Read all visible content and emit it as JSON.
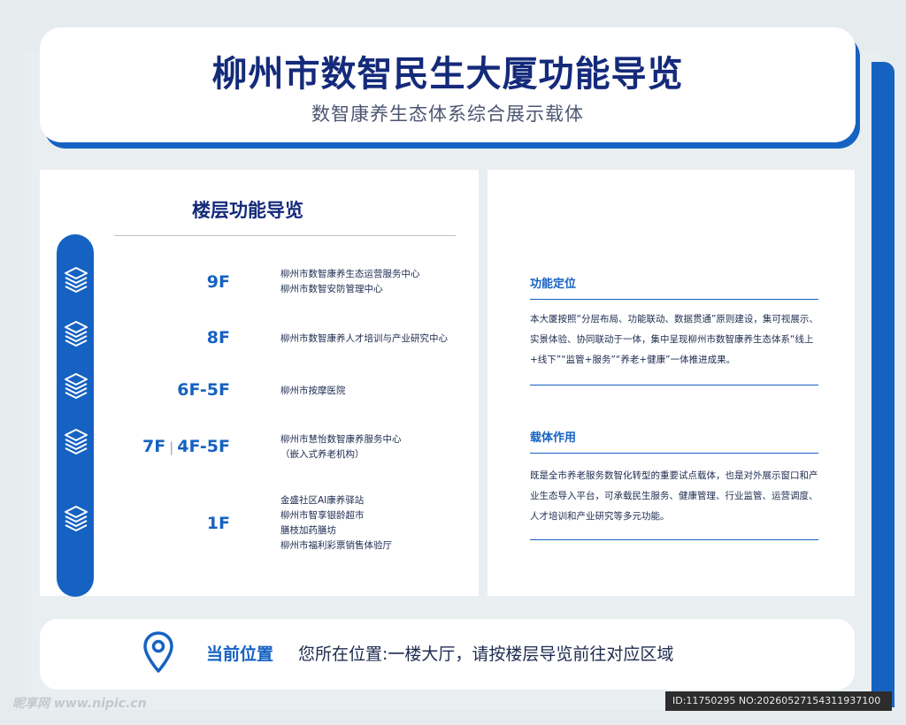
{
  "header": {
    "title": "柳州市数智民生大厦功能导览",
    "subtitle": "数智康养生态体系综合展示载体"
  },
  "floors": {
    "heading": "楼层功能导览",
    "items": [
      {
        "icon": "layers-icon",
        "label": "9F",
        "lines": [
          "柳州市数智康养生态运营服务中心",
          "柳州市数智安防管理中心"
        ]
      },
      {
        "icon": "layers-icon",
        "label": "8F",
        "lines": [
          "柳州市数智康养人才培训与产业研究中心"
        ]
      },
      {
        "icon": "layers-icon",
        "label": "6F-5F",
        "lines": [
          "柳州市按摩医院"
        ]
      },
      {
        "icon": "layers-icon",
        "label_a": "7F",
        "sep": "|",
        "label_b": "4F-5F",
        "lines": [
          "柳州市慧怡数智康养服务中心",
          "（嵌入式养老机构）"
        ]
      },
      {
        "icon": "layers-icon",
        "label": "1F",
        "lines": [
          "金盛社区AI康养驿站",
          "柳州市智享银龄超市",
          "膳枝加药膳坊",
          "柳州市福利彩票销售体验厅"
        ]
      }
    ]
  },
  "positioning": {
    "title": "功能定位",
    "text": "本大厦按照“分层布局、功能联动、数据贯通”原则建设，集可视展示、实景体验、协同联动于一体，集中呈现柳州市数智康养生态体系“线上+线下”“监管+服务”“养老+健康”一体推进成果。"
  },
  "carrier": {
    "title": "载体作用",
    "text": "既是全市养老服务数智化转型的重要试点载体，也是对外展示窗口和产业生态导入平台，可承载民生服务、健康管理、行业监管、运营调度、人才培训和产业研究等多元功能。"
  },
  "location": {
    "icon": "map-pin-icon",
    "label": "当前位置",
    "text": "您所在位置:一楼大厅，请按楼层导览前往对应区域"
  },
  "watermark": "昵享网 www.nipic.cn",
  "image_id": "ID:11750295 NO:20260527154311937100",
  "colors": {
    "primary": "#1662c2",
    "title": "#142a7a",
    "background": "#e6ebee"
  }
}
